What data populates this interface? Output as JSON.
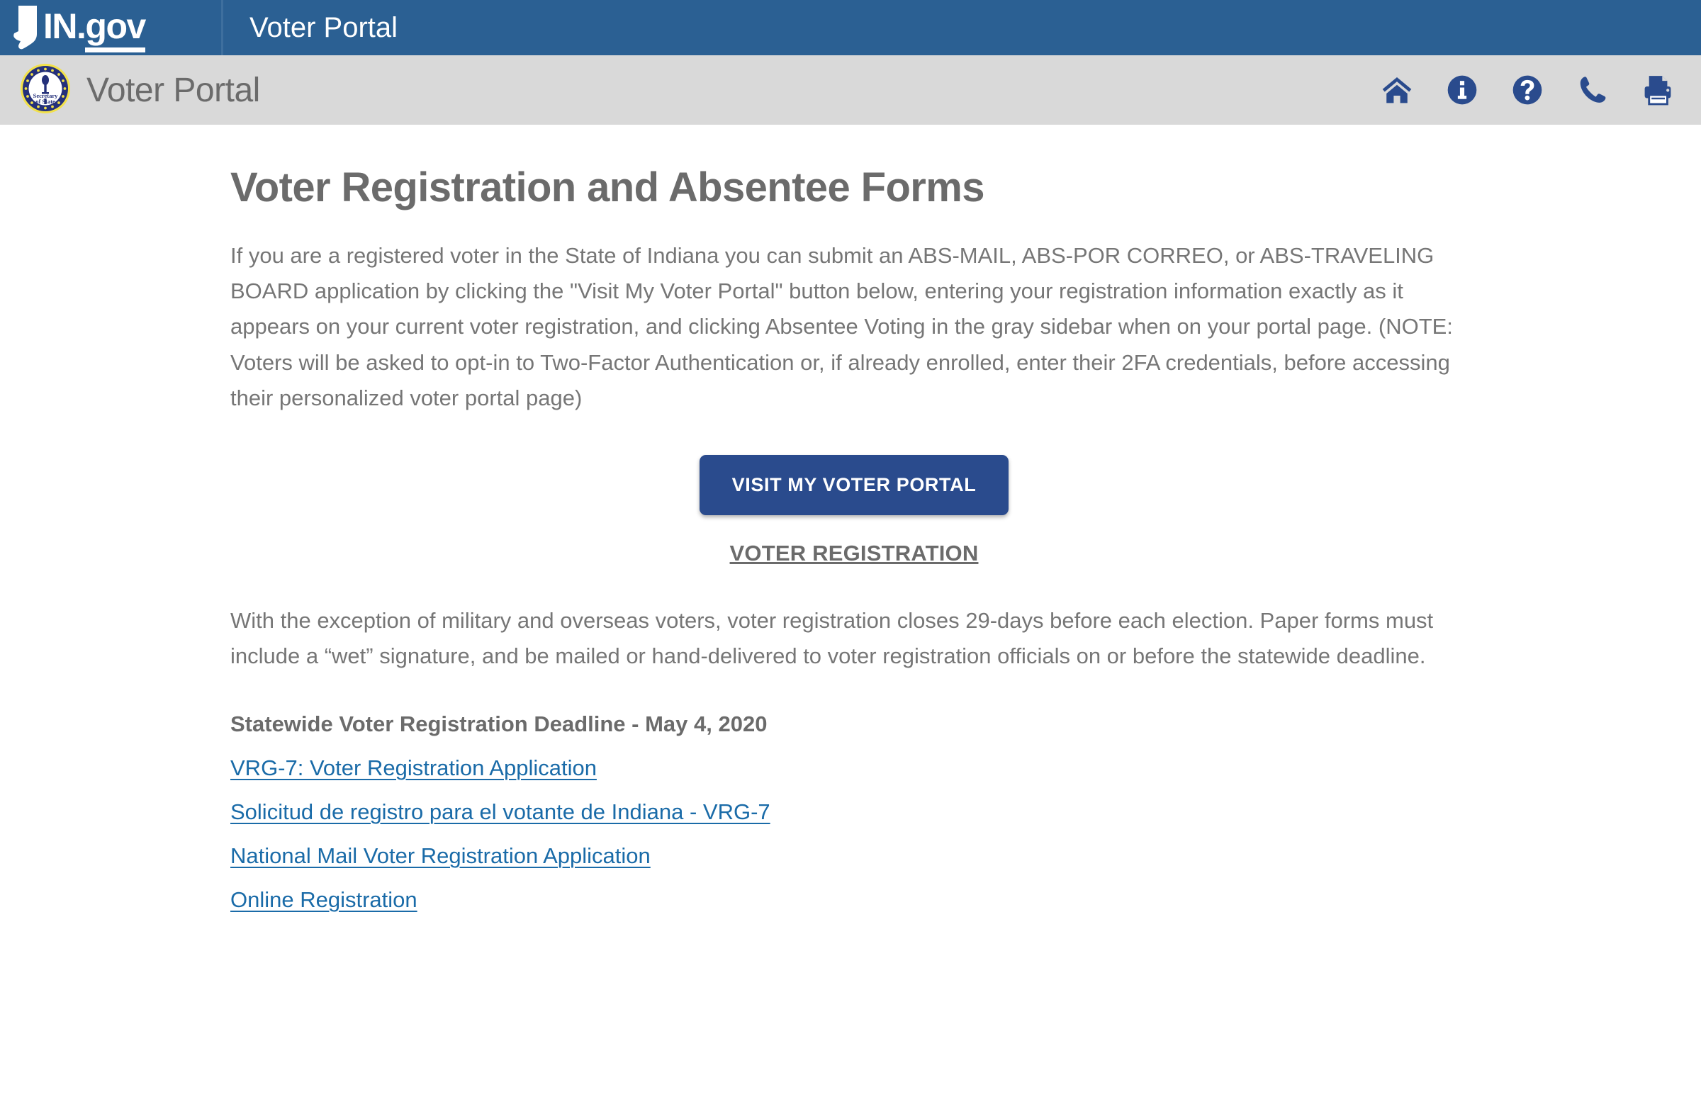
{
  "topbar": {
    "logo_name": "IN.gov",
    "logo_prefix": "IN.",
    "logo_suffix": "gov",
    "title": "Voter Portal",
    "bg_color": "#2b6093"
  },
  "subbar": {
    "title": "Voter Portal",
    "seal_alt": "Indiana Secretary of State seal",
    "bg_color": "#d9d9d9",
    "icon_color": "#2a4b8d",
    "icons": [
      {
        "name": "home-icon",
        "label": "Home"
      },
      {
        "name": "info-icon",
        "label": "Information"
      },
      {
        "name": "help-icon",
        "label": "Help"
      },
      {
        "name": "phone-icon",
        "label": "Contact"
      },
      {
        "name": "print-icon",
        "label": "Print"
      }
    ]
  },
  "main": {
    "page_title": "Voter Registration and Absentee Forms",
    "intro_paragraph": "If you are a registered voter in the State of Indiana you can submit an ABS-MAIL, ABS-POR CORREO, or ABS-TRAVELING BOARD application by clicking the \"Visit My Voter Portal\" button below, entering your registration information exactly as it appears on your current voter registration, and clicking Absentee Voting in the gray sidebar when on your portal page. (NOTE: Voters will be asked to opt-in to Two-Factor Authentication or, if already enrolled, enter their 2FA credentials, before accessing their personalized voter portal page)",
    "portal_button_label": "VISIT MY VOTER PORTAL",
    "portal_button_color": "#2a4b8d",
    "section_heading": "VOTER REGISTRATION",
    "registration_paragraph": "With the exception of military and overseas voters, voter registration closes 29-days before each election. Paper forms must include a “wet” signature, and be mailed or hand-delivered to voter registration officials on or before the statewide deadline.",
    "deadline_text": "Statewide Voter Registration Deadline - May 4, 2020",
    "link_color": "#1a6ba8",
    "links": [
      {
        "label": "VRG-7: Voter Registration Application"
      },
      {
        "label": "Solicitud de registro para el votante de Indiana - VRG-7"
      },
      {
        "label": "National Mail Voter Registration Application"
      },
      {
        "label": "Online Registration"
      }
    ]
  }
}
